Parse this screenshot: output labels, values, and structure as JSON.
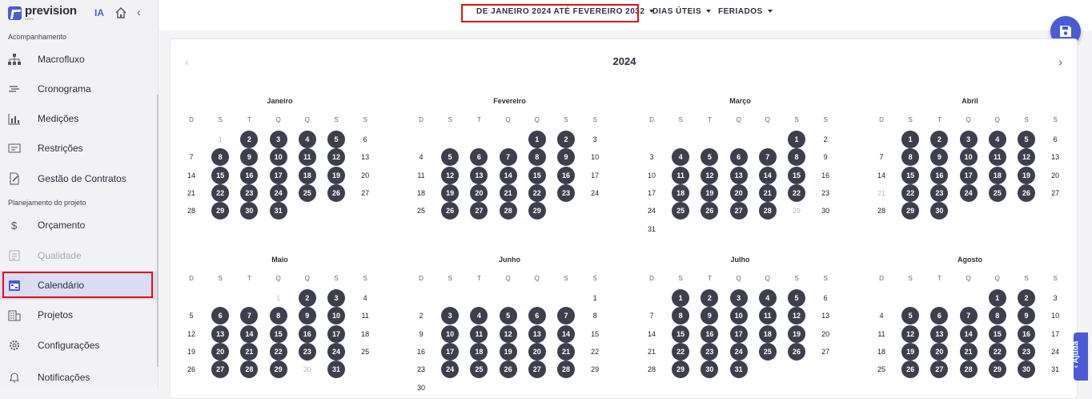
{
  "app": {
    "logo": "prevision",
    "logo_sub": "OBRA",
    "ia_label": "IA"
  },
  "sidebar": {
    "section1": "Acompanhamento",
    "section2": "Planejamento do projeto",
    "items": [
      {
        "label": "Macrofluxo",
        "icon": "hierarchy-icon"
      },
      {
        "label": "Cronograma",
        "icon": "gantt-icon"
      },
      {
        "label": "Medições",
        "icon": "bar-chart-icon"
      },
      {
        "label": "Restrições",
        "icon": "card-icon"
      },
      {
        "label": "Gestão de Contratos",
        "icon": "contract-icon"
      },
      {
        "label": "Orçamento",
        "icon": "dollar-icon"
      },
      {
        "label": "Qualidade",
        "icon": "checklist-icon"
      },
      {
        "label": "Calendário",
        "icon": "calendar-icon"
      },
      {
        "label": "Projetos",
        "icon": "building-icon"
      },
      {
        "label": "Configurações",
        "icon": "gear-icon"
      },
      {
        "label": "Notificações",
        "icon": "bell-icon"
      }
    ]
  },
  "filters": {
    "period": "DE JANEIRO 2024 ATÉ FEVEREIRO 2032",
    "days": "DIAS ÚTEIS",
    "holidays": "FERIADOS"
  },
  "calendar": {
    "year": "2024",
    "weekdays": [
      "D",
      "S",
      "T",
      "Q",
      "Q",
      "S",
      "S"
    ],
    "months": [
      {
        "name": "Janeiro",
        "start": 1,
        "days": 31,
        "dim": [
          1
        ]
      },
      {
        "name": "Fevereiro",
        "start": 4,
        "days": 29,
        "dim": []
      },
      {
        "name": "Março",
        "start": 5,
        "days": 31,
        "dim": [
          29
        ]
      },
      {
        "name": "Abril",
        "start": 1,
        "days": 30,
        "dim": [
          21
        ]
      },
      {
        "name": "Maio",
        "start": 3,
        "days": 31,
        "dim": [
          1,
          30
        ]
      },
      {
        "name": "Junho",
        "start": 6,
        "days": 30,
        "dim": []
      },
      {
        "name": "Julho",
        "start": 1,
        "days": 31,
        "dim": []
      },
      {
        "name": "Agosto",
        "start": 4,
        "days": 31,
        "dim": []
      }
    ]
  },
  "colors": {
    "accent": "#4a5bd4",
    "work_day": "#3d3f4d",
    "highlight": "#e01010"
  },
  "help": {
    "label": "Ajuda"
  }
}
